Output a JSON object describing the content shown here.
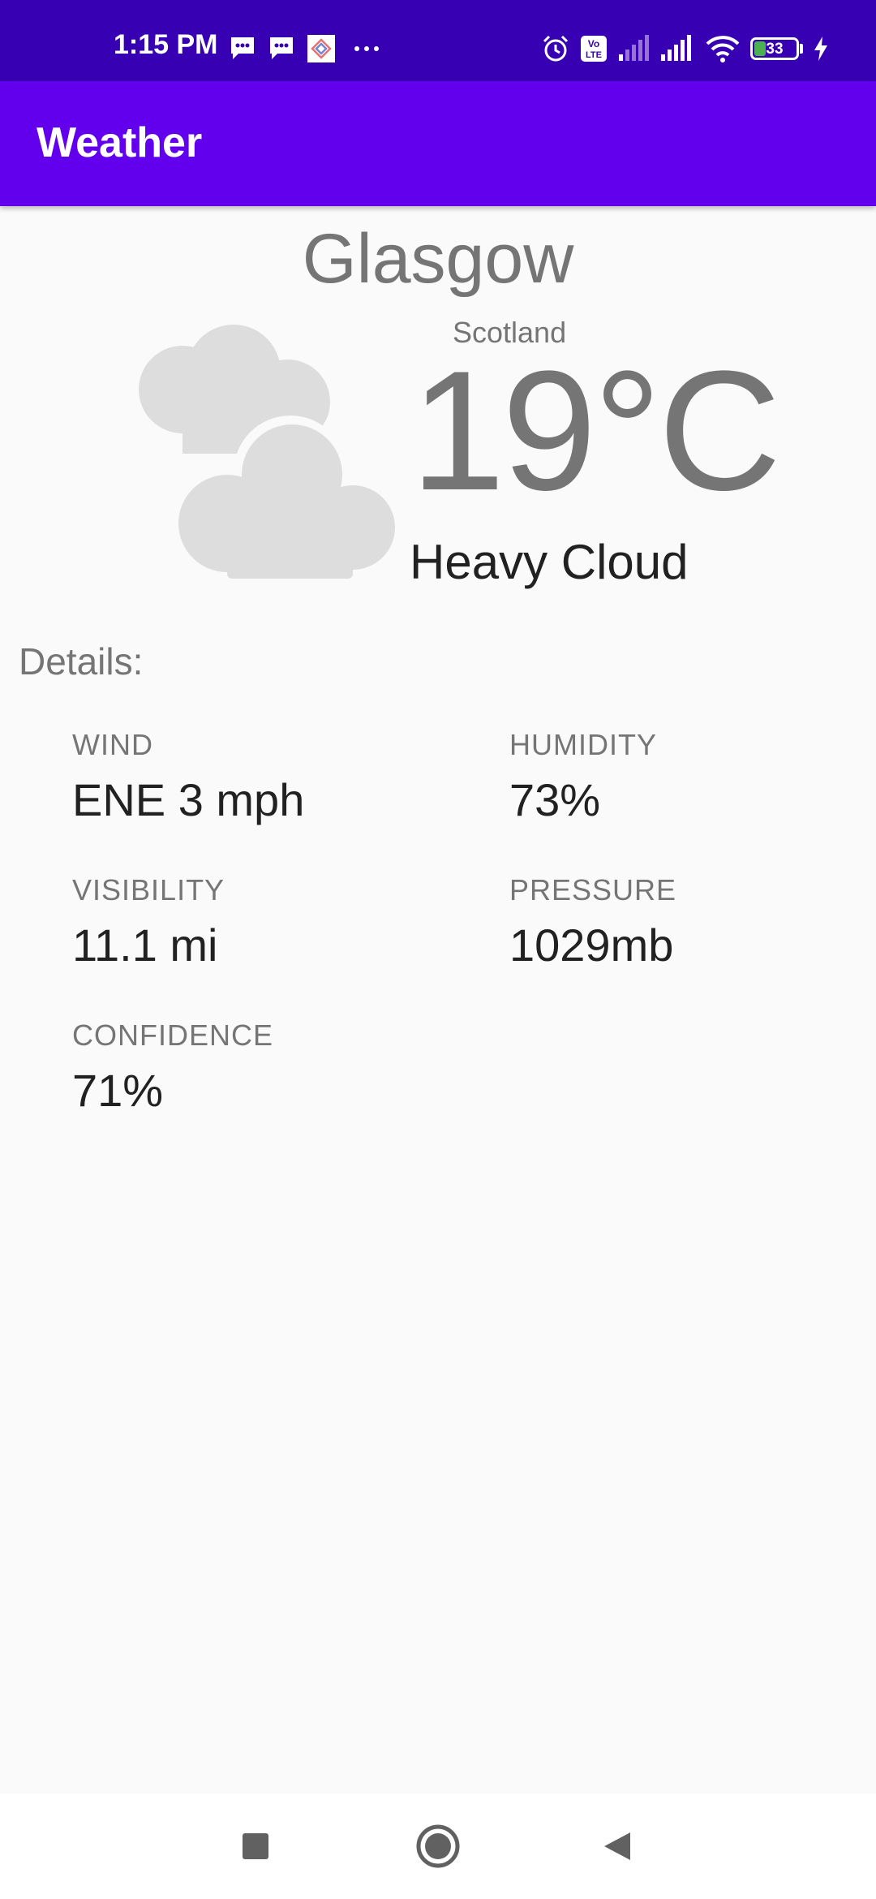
{
  "status_bar": {
    "time": "1:15 PM",
    "battery_level": "33",
    "battery_fraction": 0.33
  },
  "app_bar": {
    "title": "Weather"
  },
  "weather": {
    "city": "Glasgow",
    "region": "Scotland",
    "temperature": "19°C",
    "condition": "Heavy Cloud",
    "icon": "heavy-cloud-icon"
  },
  "details": {
    "heading": "Details:",
    "wind": {
      "label": "WIND",
      "value": "ENE 3 mph"
    },
    "humidity": {
      "label": "HUMIDITY",
      "value": "73%"
    },
    "visibility": {
      "label": "VISIBILITY",
      "value": "11.1 mi"
    },
    "pressure": {
      "label": "PRESSURE",
      "value": "1029mb"
    },
    "confidence": {
      "label": "CONFIDENCE",
      "value": "71%"
    }
  },
  "nav_bar": {
    "recents_icon": "square-icon",
    "home_icon": "circle-icon",
    "back_icon": "triangle-back-icon"
  },
  "colors": {
    "status_bar": "#3700b3",
    "app_bar": "#6200ee",
    "background": "#fafafa",
    "cloud": "#dddddd",
    "secondary_text": "#757575",
    "primary_text": "#212121",
    "battery_fill": "#4caf50"
  }
}
